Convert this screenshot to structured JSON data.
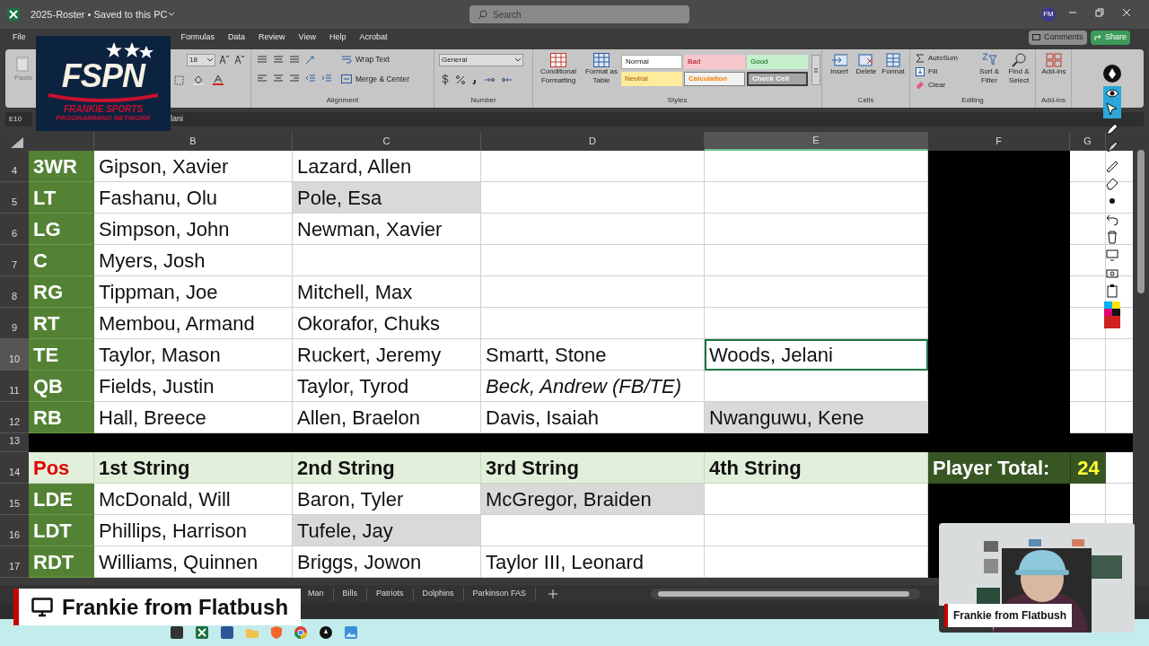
{
  "title_bar": {
    "title": "2025-Roster • Saved to this PC",
    "search_placeholder": "Search",
    "avatar": "FM"
  },
  "menu": [
    {
      "label": "File",
      "selected": false
    },
    {
      "label": "Formulas",
      "selected": false
    },
    {
      "label": "Data",
      "selected": false
    },
    {
      "label": "Review",
      "selected": false
    },
    {
      "label": "View",
      "selected": false
    },
    {
      "label": "Help",
      "selected": false
    },
    {
      "label": "Acrobat",
      "selected": false
    }
  ],
  "actions": {
    "comments": "Comments",
    "share": "Share"
  },
  "ribbon": {
    "paste": "Paste",
    "font_size": "18",
    "alignment": {
      "wrap_text": "Wrap Text",
      "merge": "Merge & Center",
      "label": "Alignment"
    },
    "number": {
      "format": "General",
      "label": "Number"
    },
    "styles": {
      "conditional": "Conditional Formatting",
      "format_table": "Format as Table",
      "label": "Styles",
      "presets": [
        {
          "label": "Normal",
          "kind": "normal"
        },
        {
          "label": "Bad",
          "kind": "bad"
        },
        {
          "label": "Good",
          "kind": "good"
        },
        {
          "label": "Neutral",
          "kind": "neutral"
        },
        {
          "label": "Calculation",
          "kind": "calculation"
        },
        {
          "label": "Check Cell",
          "kind": "check"
        }
      ]
    },
    "cells": {
      "buttons": [
        "Insert",
        "Delete",
        "Format"
      ],
      "label": "Cells"
    },
    "editing": {
      "autosum": "AutoSum",
      "fill": "Fill",
      "clear": "Clear",
      "sort": "Sort & Filter",
      "find": "Find & Select",
      "label": "Editing"
    },
    "addins": {
      "button": "Add-ins",
      "label": "Add-ins"
    }
  },
  "formula_bar": {
    "name_box": "E10",
    "formula": "lani"
  },
  "columns": [
    "B",
    "C",
    "D",
    "E",
    "F",
    "G"
  ],
  "rows": [
    {
      "number": "4",
      "kind": "player",
      "cells": [
        {
          "text": "3WR"
        },
        {
          "text": "Gipson, Xavier",
          "shaded": false,
          "italic": false,
          "selected": false
        },
        {
          "text": "Lazard, Allen",
          "shaded": false,
          "italic": false,
          "selected": false
        },
        {
          "shaded": false,
          "selected": false
        },
        {
          "shaded": false,
          "selected": false
        }
      ]
    },
    {
      "number": "5",
      "kind": "player",
      "cells": [
        {
          "text": "LT"
        },
        {
          "text": "Fashanu, Olu",
          "shaded": false,
          "italic": false,
          "selected": false
        },
        {
          "text": "Pole, Esa",
          "shaded": true,
          "italic": false,
          "selected": false
        },
        {
          "shaded": false,
          "selected": false
        },
        {
          "shaded": false,
          "selected": false
        }
      ]
    },
    {
      "number": "6",
      "kind": "player",
      "cells": [
        {
          "text": "LG"
        },
        {
          "text": "Simpson, John",
          "shaded": false,
          "italic": false,
          "selected": false
        },
        {
          "text": "Newman, Xavier",
          "shaded": false,
          "italic": false,
          "selected": false
        },
        {
          "shaded": false,
          "selected": false
        },
        {
          "shaded": false,
          "selected": false
        }
      ]
    },
    {
      "number": "7",
      "kind": "player",
      "cells": [
        {
          "text": "C"
        },
        {
          "text": "Myers, Josh",
          "shaded": false,
          "italic": false,
          "selected": false
        },
        {
          "shaded": false,
          "selected": false
        },
        {
          "shaded": false,
          "selected": false
        },
        {
          "shaded": false,
          "selected": false
        }
      ]
    },
    {
      "number": "8",
      "kind": "player",
      "cells": [
        {
          "text": "RG"
        },
        {
          "text": "Tippman, Joe",
          "shaded": false,
          "italic": false,
          "selected": false
        },
        {
          "text": "Mitchell, Max",
          "shaded": false,
          "italic": false,
          "selected": false
        },
        {
          "shaded": false,
          "selected": false
        },
        {
          "shaded": false,
          "selected": false
        }
      ]
    },
    {
      "number": "9",
      "kind": "player",
      "cells": [
        {
          "text": "RT"
        },
        {
          "text": "Membou, Armand",
          "shaded": false,
          "italic": false,
          "selected": false
        },
        {
          "text": "Okorafor, Chuks",
          "shaded": false,
          "italic": false,
          "selected": false
        },
        {
          "shaded": false,
          "selected": false
        },
        {
          "shaded": false,
          "selected": false
        }
      ]
    },
    {
      "number": "10",
      "kind": "player",
      "cells": [
        {
          "text": "TE"
        },
        {
          "text": "Taylor, Mason",
          "shaded": false,
          "italic": false,
          "selected": false
        },
        {
          "text": "Ruckert, Jeremy",
          "shaded": false,
          "italic": false,
          "selected": false
        },
        {
          "text": "Smartt, Stone",
          "shaded": false,
          "italic": false,
          "selected": false
        },
        {
          "text": "Woods, Jelani",
          "shaded": false,
          "italic": false,
          "selected": true
        }
      ]
    },
    {
      "number": "11",
      "kind": "player",
      "cells": [
        {
          "text": "QB"
        },
        {
          "text": "Fields, Justin",
          "shaded": false,
          "italic": false,
          "selected": false
        },
        {
          "text": "Taylor, Tyrod",
          "shaded": false,
          "italic": false,
          "selected": false
        },
        {
          "text": "Beck, Andrew (FB/TE)",
          "shaded": false,
          "italic": true,
          "selected": false
        },
        {
          "shaded": false,
          "selected": false
        }
      ]
    },
    {
      "number": "12",
      "kind": "player",
      "cells": [
        {
          "text": "RB"
        },
        {
          "text": "Hall, Breece",
          "shaded": false,
          "italic": false,
          "selected": false
        },
        {
          "text": "Allen, Braelon",
          "shaded": false,
          "italic": false,
          "selected": false
        },
        {
          "text": "Davis, Isaiah",
          "shaded": false,
          "italic": false,
          "selected": false
        },
        {
          "text": "Nwanguwu, Kene",
          "shaded": true,
          "italic": false,
          "selected": false
        }
      ]
    },
    {
      "number": "13",
      "kind": "separator"
    },
    {
      "number": "14",
      "kind": "header",
      "cells": [
        {
          "text": "Pos"
        },
        {
          "text": "1st String"
        },
        {
          "text": "2nd String"
        },
        {
          "text": "3rd String"
        },
        {
          "text": "4th String"
        }
      ],
      "total_label": "Player Total:",
      "total_value": "24"
    },
    {
      "number": "15",
      "kind": "player",
      "cells": [
        {
          "text": "LDE"
        },
        {
          "text": "McDonald, Will",
          "shaded": false,
          "italic": false,
          "selected": false
        },
        {
          "text": "Baron, Tyler",
          "shaded": false,
          "italic": false,
          "selected": false
        },
        {
          "text": "McGregor, Braiden",
          "shaded": true,
          "italic": false,
          "selected": false
        },
        {
          "shaded": false,
          "selected": false
        }
      ]
    },
    {
      "number": "16",
      "kind": "player",
      "cells": [
        {
          "text": "LDT"
        },
        {
          "text": "Phillips, Harrison",
          "shaded": false,
          "italic": false,
          "selected": false
        },
        {
          "text": "Tufele, Jay",
          "shaded": true,
          "italic": false,
          "selected": false
        },
        {
          "shaded": false,
          "selected": false
        },
        {
          "shaded": false,
          "selected": false
        }
      ]
    },
    {
      "number": "17",
      "kind": "player",
      "cells": [
        {
          "text": "RDT"
        },
        {
          "text": "Williams, Quinnen",
          "shaded": false,
          "italic": false,
          "selected": false
        },
        {
          "text": "Briggs, Jowon",
          "shaded": false,
          "italic": false,
          "selected": false
        },
        {
          "text": "Taylor III, Leonard",
          "shaded": false,
          "italic": false,
          "selected": false
        },
        {
          "shaded": false,
          "selected": false
        }
      ]
    }
  ],
  "sheet_tabs": [
    {
      "label": "Man",
      "selected": false
    },
    {
      "label": "Bills",
      "selected": false
    },
    {
      "label": "Patriots",
      "selected": false
    },
    {
      "label": "Dolphins",
      "selected": false
    },
    {
      "label": "Parkinson FAS",
      "selected": false
    }
  ],
  "logo": {
    "name": "FSPN",
    "tagline_1": "FRANKIE SPORTS",
    "tagline_2": "PROGRAMMING NETWORK"
  },
  "banner": {
    "text": "Frankie from Flatbush"
  },
  "webcam": {
    "kind": "picture",
    "caption": "Frankie from Flatbush"
  }
}
